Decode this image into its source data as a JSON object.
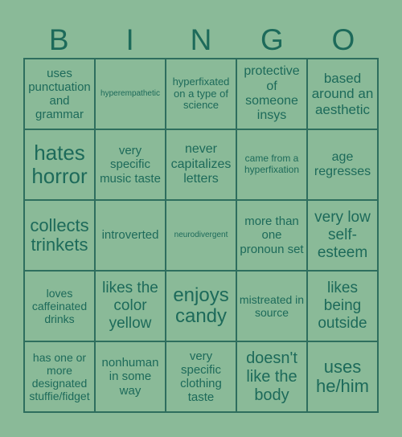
{
  "header": {
    "letters": [
      "B",
      "I",
      "N",
      "G",
      "O"
    ]
  },
  "colors": {
    "background": "#8aba98",
    "text": "#1d6a5a",
    "grid_line": "#2e6e5e"
  },
  "cells": [
    [
      "uses punctuation and grammar",
      "hyperempathetic",
      "hyperfixated on a type of science",
      "protective of someone insys",
      "based around an aesthetic"
    ],
    [
      "hates horror",
      "very specific music taste",
      "never capitalizes letters",
      "came from a hyperfixation",
      "age regresses"
    ],
    [
      "collects trinkets",
      "introverted",
      "neurodivergent",
      "more than one pronoun set",
      "very low self-esteem"
    ],
    [
      "loves caffeinated drinks",
      "likes the color yellow",
      "enjoys candy",
      "mistreated in source",
      "likes being outside"
    ],
    [
      "has one or more designated stuffie/fidget",
      "nonhuman in some way",
      "very specific clothing taste",
      "doesn't like the body",
      "uses he/him"
    ]
  ]
}
